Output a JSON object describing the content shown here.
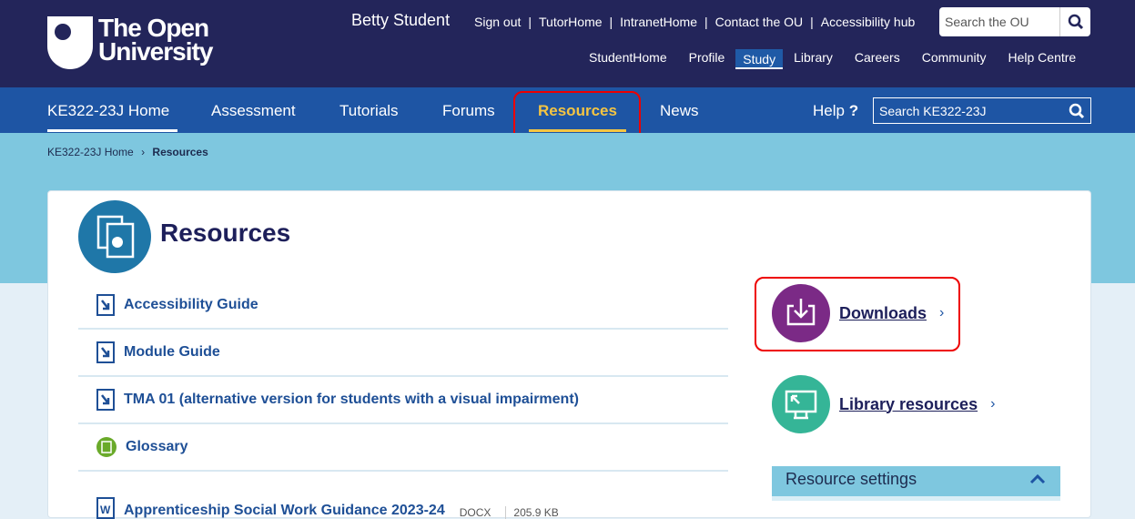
{
  "header": {
    "logo_text": [
      "The Open",
      "University"
    ],
    "user": "Betty Student",
    "top_links": [
      "Sign out",
      "TutorHome",
      "IntranetHome",
      "Contact the OU",
      "Accessibility hub"
    ],
    "search_placeholder": "Search the OU",
    "sub_nav": [
      "StudentHome",
      "Profile",
      "Study",
      "Library",
      "Careers",
      "Community",
      "Help Centre"
    ],
    "active_sub": "Study"
  },
  "nav": {
    "items": [
      "KE322-23J Home",
      "Assessment",
      "Tutorials",
      "Forums",
      "Resources",
      "News"
    ],
    "help": "Help",
    "search_placeholder": "Search KE322-23J"
  },
  "breadcrumb": [
    "KE322-23J Home",
    "Resources"
  ],
  "page": {
    "title": "Resources",
    "resources": [
      {
        "label": "Accessibility Guide",
        "icon": "document-link-icon"
      },
      {
        "label": "Module Guide",
        "icon": "document-link-icon"
      },
      {
        "label": "TMA 01 (alternative version for students with a visual impairment)",
        "icon": "document-link-icon"
      },
      {
        "label": "Glossary",
        "icon": "glossary-icon"
      },
      {
        "label": "Apprenticeship Social Work Guidance 2023-24",
        "icon": "word-icon",
        "type": "DOCX",
        "size": "205.9 KB"
      }
    ],
    "side_links": [
      {
        "label": "Downloads",
        "color": "#7b2a86"
      },
      {
        "label": "Library resources",
        "color": "#35b597"
      }
    ],
    "settings": "Resource settings"
  }
}
